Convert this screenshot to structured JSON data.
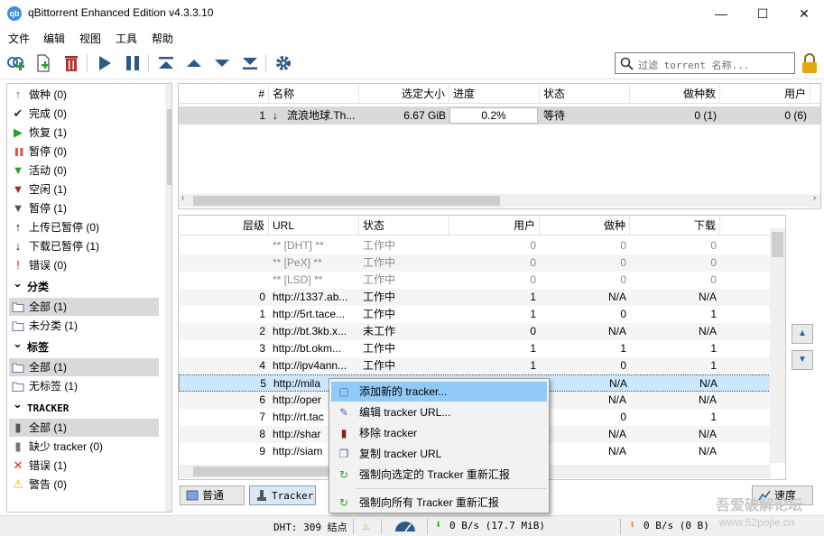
{
  "window": {
    "title": "qBittorrent Enhanced Edition v4.3.3.10",
    "icon_text": "qb",
    "controls": {
      "minimize": "—",
      "maximize": "☐",
      "close": "✕"
    }
  },
  "menu": [
    "文件",
    "编辑",
    "视图",
    "工具",
    "帮助"
  ],
  "toolbar": {
    "icons": [
      "add-link-icon",
      "add-file-icon",
      "delete-icon",
      "resume-icon",
      "pause-icon",
      "top-priority-icon",
      "increase-priority-icon",
      "decrease-priority-icon",
      "bottom-priority-icon",
      "options-icon"
    ],
    "search_placeholder": "过滤 torrent 名称..."
  },
  "sidebar": {
    "status": [
      {
        "label": "做种 (0)",
        "icon": "↑",
        "color": "#1f6fd6"
      },
      {
        "label": "完成 (0)",
        "icon": "✔",
        "color": "#333333"
      },
      {
        "label": "恢复 (1)",
        "icon": "▶",
        "color": "#2aa02a"
      },
      {
        "label": "暂停 (0)",
        "icon": "❚❚",
        "color": "#e05050"
      },
      {
        "label": "活动 (0)",
        "icon": "▼",
        "color": "#2aa02a"
      },
      {
        "label": "空闲 (1)",
        "icon": "▼",
        "color": "#a03030"
      },
      {
        "label": "暂停 (1)",
        "icon": "▼",
        "color": "#555555"
      },
      {
        "label": "上传已暂停 (0)",
        "icon": "↑",
        "color": "#111111"
      },
      {
        "label": "下载已暂停 (1)",
        "icon": "↓",
        "color": "#111111"
      },
      {
        "label": "错误 (0)",
        "icon": "!",
        "color": "#e02020"
      }
    ],
    "categories_title": "分类",
    "categories": [
      {
        "label": "全部 (1)",
        "selected": true
      },
      {
        "label": "未分类 (1)",
        "selected": false
      }
    ],
    "tags_title": "标签",
    "tags": [
      {
        "label": "全部 (1)",
        "selected": true
      },
      {
        "label": "无标签 (1)",
        "selected": false
      }
    ],
    "trackers_title": "TRACKER",
    "trackers": [
      {
        "label": "全部 (1)",
        "selected": true,
        "icon": "▮",
        "color": "#555555"
      },
      {
        "label": "缺少 tracker (0)",
        "selected": false,
        "icon": "▮",
        "color": "#777777"
      },
      {
        "label": "错误 (1)",
        "selected": false,
        "icon": "✕",
        "color": "#e02020"
      },
      {
        "label": "警告 (0)",
        "selected": false,
        "icon": "⚠",
        "color": "#e8b000"
      }
    ]
  },
  "torrents": {
    "headers": {
      "num": "#",
      "name": "名称",
      "size": "选定大小",
      "progress": "进度",
      "status": "状态",
      "seeds": "做种数",
      "peers": "用户"
    },
    "rows": [
      {
        "num": "1",
        "name": "流浪地球.Th...",
        "size": "6.67 GiB",
        "progress": "0.2%",
        "progress_value": 0.2,
        "status": "等待",
        "seeds": "0 (1)",
        "peers": "0 (6)"
      }
    ]
  },
  "trackers_table": {
    "headers": {
      "tier": "层级",
      "url": "URL",
      "status": "状态",
      "peers": "用户",
      "seeds": "做种",
      "downloaded": "下载"
    },
    "rows": [
      {
        "tier": "",
        "url": "** [DHT] **",
        "status": "工作中",
        "peers": "0",
        "seeds": "0",
        "downloaded": "0",
        "dim": true
      },
      {
        "tier": "",
        "url": "** [PeX] **",
        "status": "工作中",
        "peers": "0",
        "seeds": "0",
        "downloaded": "0",
        "dim": true
      },
      {
        "tier": "",
        "url": "** [LSD] **",
        "status": "工作中",
        "peers": "0",
        "seeds": "0",
        "downloaded": "0",
        "dim": true
      },
      {
        "tier": "0",
        "url": "http://1337.ab...",
        "status": "工作中",
        "peers": "1",
        "seeds": "N/A",
        "downloaded": "N/A"
      },
      {
        "tier": "1",
        "url": "http://5rt.tace...",
        "status": "工作中",
        "peers": "1",
        "seeds": "0",
        "downloaded": "1"
      },
      {
        "tier": "2",
        "url": "http://bt.3kb.x...",
        "status": "未工作",
        "peers": "0",
        "seeds": "N/A",
        "downloaded": "N/A"
      },
      {
        "tier": "3",
        "url": "http://bt.okm...",
        "status": "工作中",
        "peers": "1",
        "seeds": "1",
        "downloaded": "1"
      },
      {
        "tier": "4",
        "url": "http://ipv4ann...",
        "status": "工作中",
        "peers": "1",
        "seeds": "0",
        "downloaded": "1"
      },
      {
        "tier": "5",
        "url": "http://mila",
        "status": "",
        "peers": "",
        "seeds": "N/A",
        "downloaded": "N/A",
        "selected": true
      },
      {
        "tier": "6",
        "url": "http://oper",
        "status": "",
        "peers": "",
        "seeds": "N/A",
        "downloaded": "N/A"
      },
      {
        "tier": "7",
        "url": "http://rt.tac",
        "status": "",
        "peers": "",
        "seeds": "0",
        "downloaded": "1"
      },
      {
        "tier": "8",
        "url": "http://shar",
        "status": "",
        "peers": "",
        "seeds": "N/A",
        "downloaded": "N/A"
      },
      {
        "tier": "9",
        "url": "http://siam",
        "status": "",
        "peers": "",
        "seeds": "N/A",
        "downloaded": "N/A"
      }
    ]
  },
  "context_menu": [
    {
      "label": "添加新的 tracker...",
      "icon": "▢",
      "color": "#4a6fa5",
      "highlighted": true
    },
    {
      "label": "编辑 tracker URL...",
      "icon": "✎",
      "color": "#4a6fa5"
    },
    {
      "label": "移除 tracker",
      "icon": "▮",
      "color": "#8b1a1a"
    },
    {
      "label": "复制 tracker URL",
      "icon": "❐",
      "color": "#4a6fa5"
    },
    {
      "label": "强制向选定的 Tracker 重新汇报",
      "icon": "↻",
      "color": "#2aa02a"
    },
    {
      "label": "强制向所有 Tracker 重新汇报",
      "icon": "↻",
      "color": "#2aa02a"
    }
  ],
  "bottom_tabs": [
    {
      "label": "普通",
      "selected": false
    },
    {
      "label": "Tracker",
      "selected": true
    },
    {
      "label": "速度",
      "selected": false
    }
  ],
  "statusbar": {
    "dht": "DHT: 309 结点",
    "download": "0 B/s (17.7 MiB)",
    "upload": "0 B/s (0 B)"
  },
  "watermark": {
    "line1": "吾爱破解论坛",
    "line2": "www.52pojie.cn"
  }
}
